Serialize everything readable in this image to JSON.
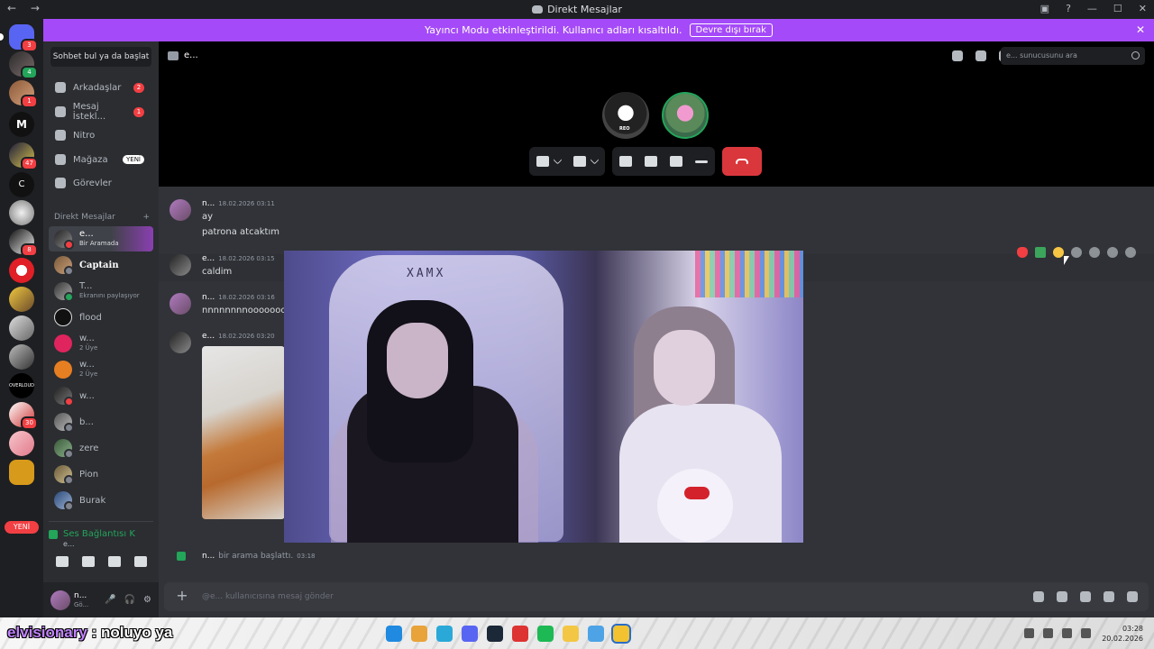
{
  "titlebar": {
    "title": "Direkt Mesajlar",
    "nav": "← →",
    "controls": [
      "▣",
      "?",
      "—",
      "☐",
      "✕"
    ]
  },
  "banner": {
    "text": "Yayıncı Modu etkinleştirildi. Kullanıcı adları kısaltıldı.",
    "button": "Devre dışı bırak",
    "close": "✕"
  },
  "guilds": {
    "badges": [
      "3",
      "4",
      "1",
      "47",
      "8",
      "30"
    ],
    "letters": [
      "M",
      "C"
    ],
    "overloud": "OVERLOUD",
    "new_pill": "YENİ"
  },
  "sidebar": {
    "search": "Sohbet bul ya da başlat",
    "nav": [
      {
        "label": "Arkadaşlar",
        "count": "2"
      },
      {
        "label": "Mesaj İstekl...",
        "count": "1"
      },
      {
        "label": "Nitro"
      },
      {
        "label": "Mağaza",
        "tag": "YENİ"
      },
      {
        "label": "Görevler"
      }
    ],
    "dm_header": "Direkt Mesajlar",
    "dm_add": "+",
    "dms": [
      {
        "name": "e...",
        "sub": "Bir Aramada"
      },
      {
        "name": "Captain",
        "sub": ""
      },
      {
        "name": "T...",
        "sub": "Ekranını paylaşıyor"
      },
      {
        "name": "flood",
        "sub": ""
      },
      {
        "name": "w...",
        "sub": "2 Üye"
      },
      {
        "name": "w...",
        "sub": "2 Üye"
      },
      {
        "name": "w...",
        "sub": ""
      },
      {
        "name": "b...",
        "sub": ""
      },
      {
        "name": "zere",
        "sub": ""
      },
      {
        "name": "Pion",
        "sub": ""
      },
      {
        "name": "Burak",
        "sub": ""
      }
    ],
    "voice": {
      "title": "Ses Bağlantısı K",
      "sub": "e..."
    },
    "user": {
      "name": "n...",
      "status": "Gö..."
    }
  },
  "call": {
    "header": "e...",
    "server_search": "e... sunucusunu ara",
    "avatar_label": "REO"
  },
  "messages": [
    {
      "author": "n...",
      "time": "18.02.2026 03:11",
      "lines": [
        "ay",
        "patrona atcaktım"
      ]
    },
    {
      "author": "e...",
      "time": "18.02.2026 03:15",
      "lines": [
        "caldim"
      ]
    },
    {
      "author": "n...",
      "time": "18.02.2026 03:16",
      "lines": [
        "nnnnnnnnooooooo"
      ]
    },
    {
      "author": "e...",
      "time": "18.02.2026 03:20",
      "lines": []
    }
  ],
  "stream": {
    "chair_logo": "XAMX"
  },
  "system_message": {
    "author": "n...",
    "text": "bir arama başlattı.",
    "time": "03:18"
  },
  "composer": {
    "placeholder": "@e... kullanıcısına mesaj gönder"
  },
  "overlay": {
    "name": "elvisionary",
    "text": ": noluyo ya"
  },
  "clock": {
    "time": "03:28",
    "date": "20.02.2026"
  },
  "colors": {
    "brand": "#5865f2",
    "banner": "#a54af8",
    "end_call": "#da373c",
    "online": "#23a55a",
    "mention": "#f23f43"
  }
}
